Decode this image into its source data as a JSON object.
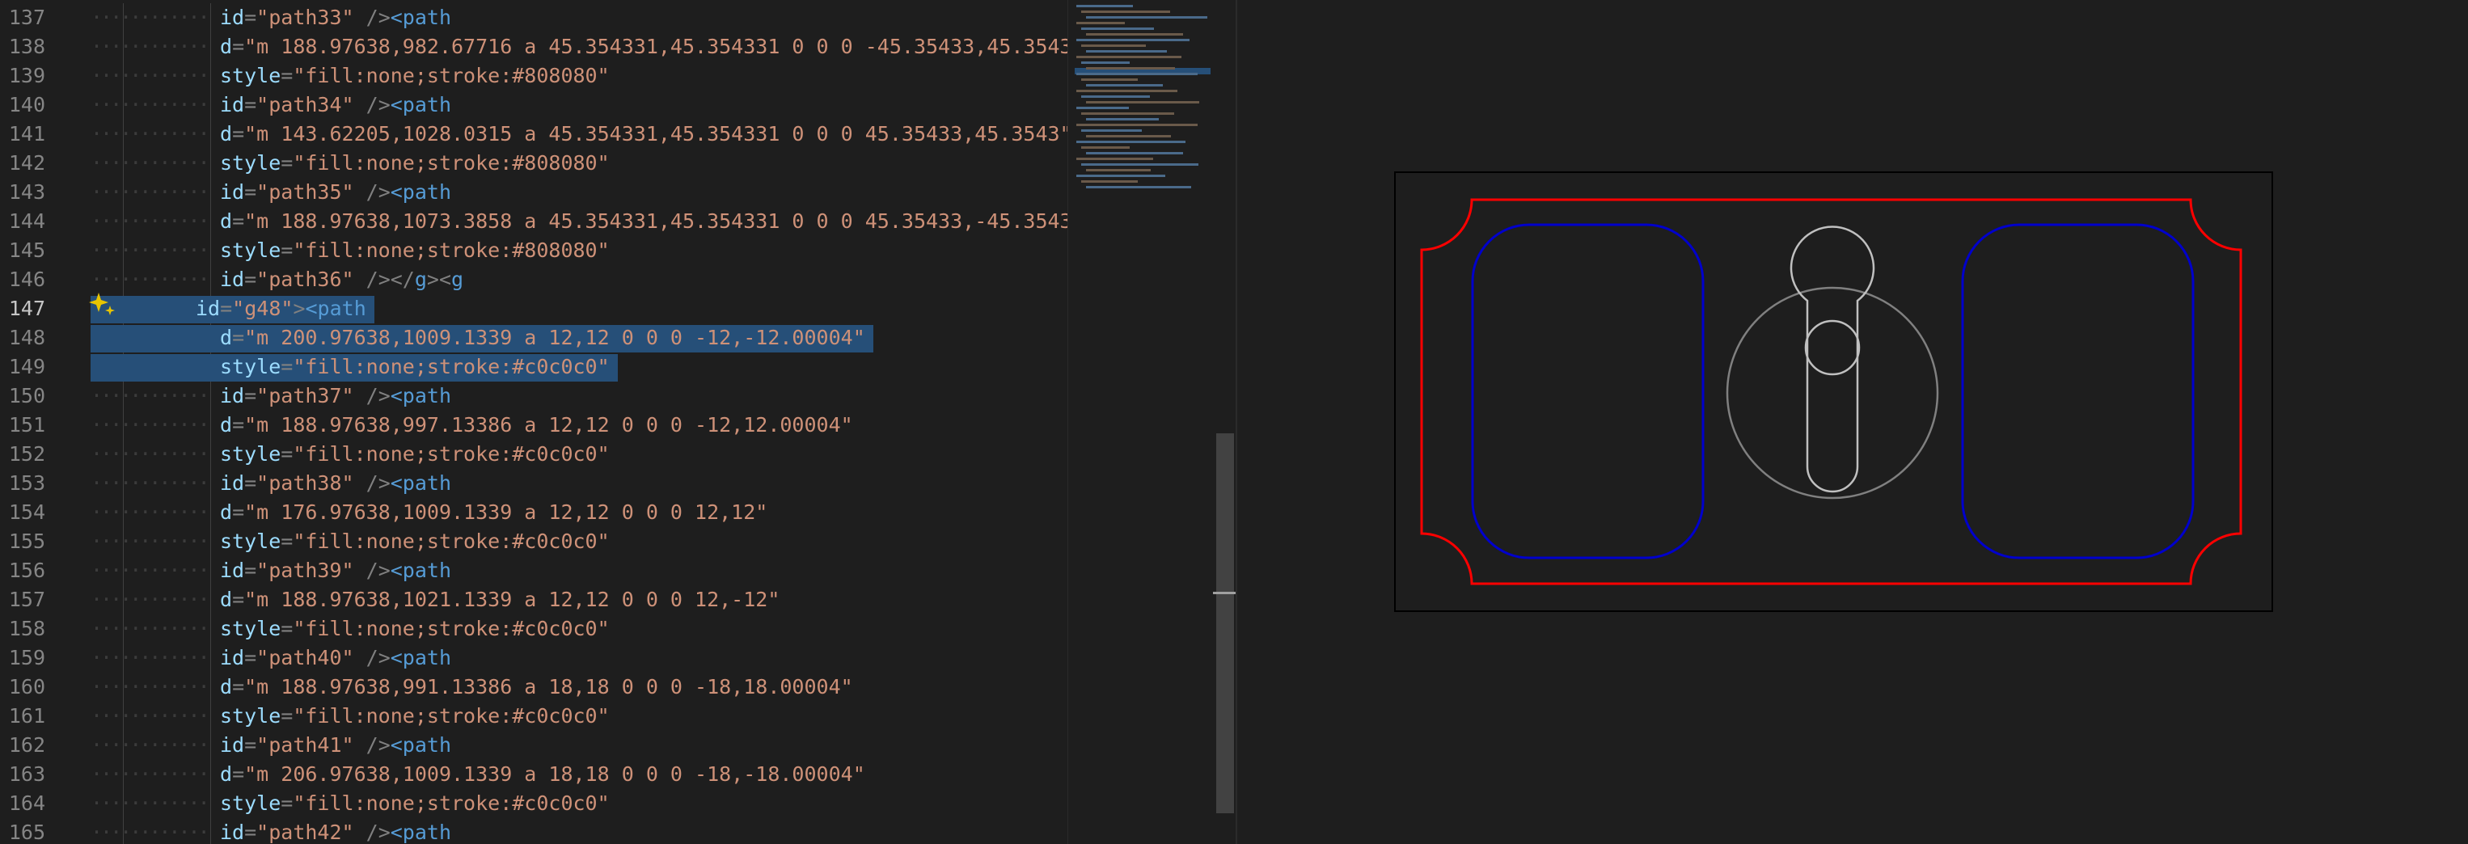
{
  "editor": {
    "lines": [
      {
        "n": "137",
        "indent": 2,
        "parts": [
          [
            "attr",
            "id"
          ],
          [
            "punc",
            "="
          ],
          [
            "str",
            "\"path33\""
          ],
          [
            "punc",
            " />"
          ],
          [
            "tag",
            "<path"
          ]
        ]
      },
      {
        "n": "138",
        "indent": 2,
        "parts": [
          [
            "attr",
            "d"
          ],
          [
            "punc",
            "="
          ],
          [
            "str",
            "\"m 188.97638,982.67716 a 45.354331,45.354331 0 0 0 -45.35433,45.3543"
          ]
        ]
      },
      {
        "n": "139",
        "indent": 2,
        "parts": [
          [
            "attr",
            "style"
          ],
          [
            "punc",
            "="
          ],
          [
            "str",
            "\"fill:none;stroke:#808080\""
          ]
        ]
      },
      {
        "n": "140",
        "indent": 2,
        "parts": [
          [
            "attr",
            "id"
          ],
          [
            "punc",
            "="
          ],
          [
            "str",
            "\"path34\""
          ],
          [
            "punc",
            " />"
          ],
          [
            "tag",
            "<path"
          ]
        ]
      },
      {
        "n": "141",
        "indent": 2,
        "parts": [
          [
            "attr",
            "d"
          ],
          [
            "punc",
            "="
          ],
          [
            "str",
            "\"m 143.62205,1028.0315 a 45.354331,45.354331 0 0 0 45.35433,45.3543\""
          ]
        ]
      },
      {
        "n": "142",
        "indent": 2,
        "parts": [
          [
            "attr",
            "style"
          ],
          [
            "punc",
            "="
          ],
          [
            "str",
            "\"fill:none;stroke:#808080\""
          ]
        ]
      },
      {
        "n": "143",
        "indent": 2,
        "parts": [
          [
            "attr",
            "id"
          ],
          [
            "punc",
            "="
          ],
          [
            "str",
            "\"path35\""
          ],
          [
            "punc",
            " />"
          ],
          [
            "tag",
            "<path"
          ]
        ]
      },
      {
        "n": "144",
        "indent": 2,
        "parts": [
          [
            "attr",
            "d"
          ],
          [
            "punc",
            "="
          ],
          [
            "str",
            "\"m 188.97638,1073.3858 a 45.354331,45.354331 0 0 0 45.35433,-45.3543"
          ]
        ]
      },
      {
        "n": "145",
        "indent": 2,
        "parts": [
          [
            "attr",
            "style"
          ],
          [
            "punc",
            "="
          ],
          [
            "str",
            "\"fill:none;stroke:#808080\""
          ]
        ]
      },
      {
        "n": "146",
        "indent": 2,
        "parts": [
          [
            "attr",
            "id"
          ],
          [
            "punc",
            "="
          ],
          [
            "str",
            "\"path36\""
          ],
          [
            "punc",
            " /></"
          ],
          [
            "tag",
            "g"
          ],
          [
            "punc",
            "><"
          ],
          [
            "tag",
            "g"
          ]
        ]
      },
      {
        "n": "147",
        "indent": 1,
        "active": true,
        "sel": true,
        "parts": [
          [
            "attr",
            "id"
          ],
          [
            "punc",
            "="
          ],
          [
            "str",
            "\"g48\""
          ],
          [
            "punc",
            ">"
          ],
          [
            "tag",
            "<path"
          ]
        ]
      },
      {
        "n": "148",
        "indent": 2,
        "sel": true,
        "parts": [
          [
            "attr",
            "d"
          ],
          [
            "punc",
            "="
          ],
          [
            "str",
            "\"m 200.97638,1009.1339 a 12,12 0 0 0 -12,-12.00004\""
          ]
        ]
      },
      {
        "n": "149",
        "indent": 2,
        "sel": true,
        "parts": [
          [
            "attr",
            "style"
          ],
          [
            "punc",
            "="
          ],
          [
            "str",
            "\"fill:none;stroke:#c0c0c0\""
          ]
        ]
      },
      {
        "n": "150",
        "indent": 2,
        "parts": [
          [
            "attr",
            "id"
          ],
          [
            "punc",
            "="
          ],
          [
            "str",
            "\"path37\""
          ],
          [
            "punc",
            " />"
          ],
          [
            "tag",
            "<path"
          ]
        ]
      },
      {
        "n": "151",
        "indent": 2,
        "parts": [
          [
            "attr",
            "d"
          ],
          [
            "punc",
            "="
          ],
          [
            "str",
            "\"m 188.97638,997.13386 a 12,12 0 0 0 -12,12.00004\""
          ]
        ]
      },
      {
        "n": "152",
        "indent": 2,
        "parts": [
          [
            "attr",
            "style"
          ],
          [
            "punc",
            "="
          ],
          [
            "str",
            "\"fill:none;stroke:#c0c0c0\""
          ]
        ]
      },
      {
        "n": "153",
        "indent": 2,
        "parts": [
          [
            "attr",
            "id"
          ],
          [
            "punc",
            "="
          ],
          [
            "str",
            "\"path38\""
          ],
          [
            "punc",
            " />"
          ],
          [
            "tag",
            "<path"
          ]
        ]
      },
      {
        "n": "154",
        "indent": 2,
        "parts": [
          [
            "attr",
            "d"
          ],
          [
            "punc",
            "="
          ],
          [
            "str",
            "\"m 176.97638,1009.1339 a 12,12 0 0 0 12,12\""
          ]
        ]
      },
      {
        "n": "155",
        "indent": 2,
        "parts": [
          [
            "attr",
            "style"
          ],
          [
            "punc",
            "="
          ],
          [
            "str",
            "\"fill:none;stroke:#c0c0c0\""
          ]
        ]
      },
      {
        "n": "156",
        "indent": 2,
        "parts": [
          [
            "attr",
            "id"
          ],
          [
            "punc",
            "="
          ],
          [
            "str",
            "\"path39\""
          ],
          [
            "punc",
            " />"
          ],
          [
            "tag",
            "<path"
          ]
        ]
      },
      {
        "n": "157",
        "indent": 2,
        "parts": [
          [
            "attr",
            "d"
          ],
          [
            "punc",
            "="
          ],
          [
            "str",
            "\"m 188.97638,1021.1339 a 12,12 0 0 0 12,-12\""
          ]
        ]
      },
      {
        "n": "158",
        "indent": 2,
        "parts": [
          [
            "attr",
            "style"
          ],
          [
            "punc",
            "="
          ],
          [
            "str",
            "\"fill:none;stroke:#c0c0c0\""
          ]
        ]
      },
      {
        "n": "159",
        "indent": 2,
        "parts": [
          [
            "attr",
            "id"
          ],
          [
            "punc",
            "="
          ],
          [
            "str",
            "\"path40\""
          ],
          [
            "punc",
            " />"
          ],
          [
            "tag",
            "<path"
          ]
        ]
      },
      {
        "n": "160",
        "indent": 2,
        "parts": [
          [
            "attr",
            "d"
          ],
          [
            "punc",
            "="
          ],
          [
            "str",
            "\"m 188.97638,991.13386 a 18,18 0 0 0 -18,18.00004\""
          ]
        ]
      },
      {
        "n": "161",
        "indent": 2,
        "parts": [
          [
            "attr",
            "style"
          ],
          [
            "punc",
            "="
          ],
          [
            "str",
            "\"fill:none;stroke:#c0c0c0\""
          ]
        ]
      },
      {
        "n": "162",
        "indent": 2,
        "parts": [
          [
            "attr",
            "id"
          ],
          [
            "punc",
            "="
          ],
          [
            "str",
            "\"path41\""
          ],
          [
            "punc",
            " />"
          ],
          [
            "tag",
            "<path"
          ]
        ]
      },
      {
        "n": "163",
        "indent": 2,
        "parts": [
          [
            "attr",
            "d"
          ],
          [
            "punc",
            "="
          ],
          [
            "str",
            "\"m 206.97638,1009.1339 a 18,18 0 0 0 -18,-18.00004\""
          ]
        ]
      },
      {
        "n": "164",
        "indent": 2,
        "parts": [
          [
            "attr",
            "style"
          ],
          [
            "punc",
            "="
          ],
          [
            "str",
            "\"fill:none;stroke:#c0c0c0\""
          ]
        ]
      },
      {
        "n": "165",
        "indent": 2,
        "parts": [
          [
            "attr",
            "id"
          ],
          [
            "punc",
            "="
          ],
          [
            "str",
            "\"path42\""
          ],
          [
            "punc",
            " />"
          ],
          [
            "tag",
            "<path"
          ]
        ]
      }
    ]
  },
  "colors": {
    "background": "#1e1e1e",
    "selection": "#264f78",
    "outline": "#ff0000",
    "pockets": "#0000cc",
    "lock": "#c0c0c0",
    "lock_ring": "#808080",
    "frame": "#000000"
  },
  "icons": {
    "sparkle": "sparkle-icon"
  }
}
